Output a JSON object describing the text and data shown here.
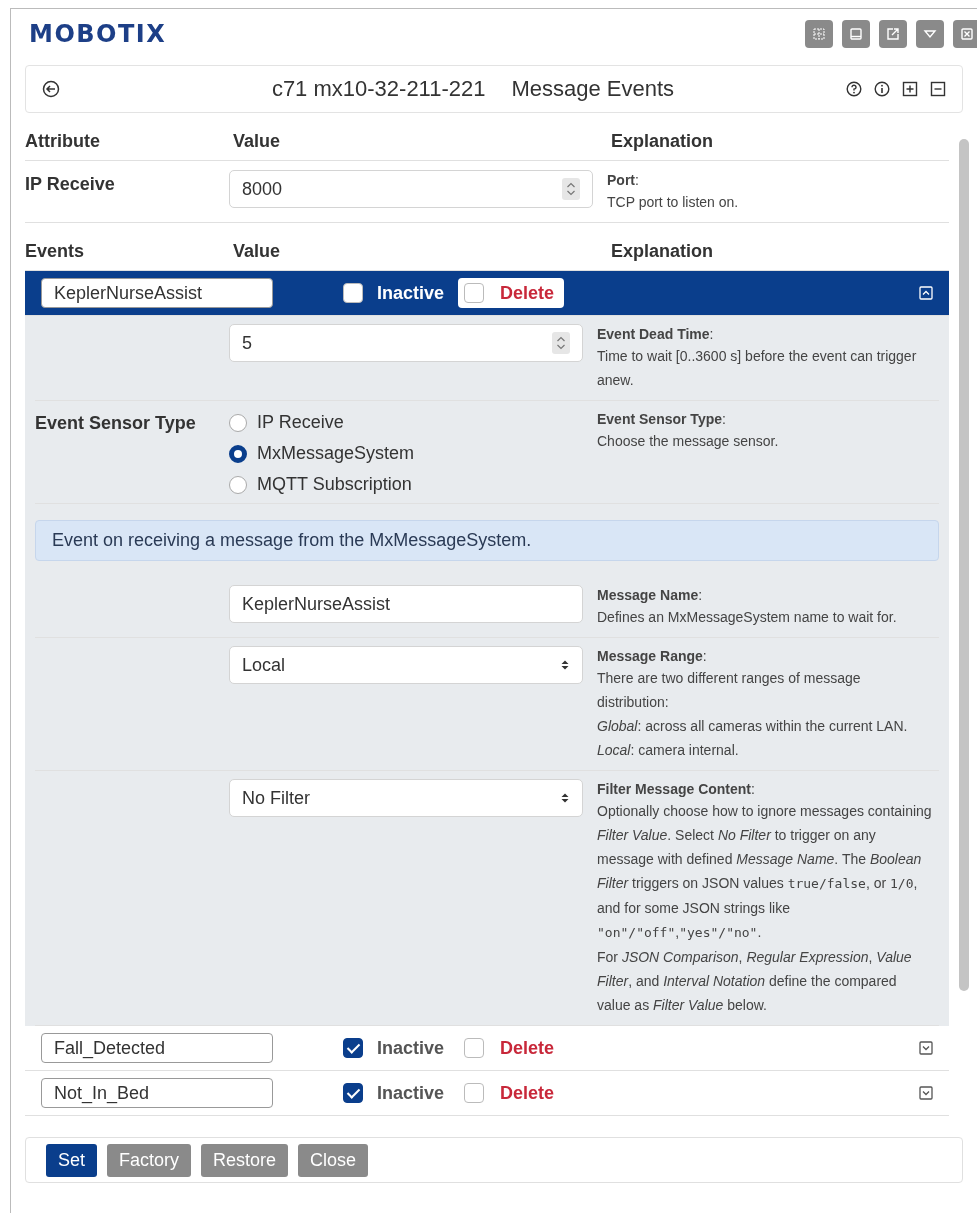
{
  "brand": "MOBOTIX",
  "title_bar": {
    "device": "c71 mx10-32-211-221",
    "title": "Message Events"
  },
  "header": [
    "Attribute",
    "Value",
    "Explanation"
  ],
  "ip_receive": {
    "label": "IP Receive",
    "value": "8000",
    "explanation": {
      "title": "**Port**:",
      "paragraphs": [
        [
          {
            "text": "TCP port to listen on."
          }
        ]
      ]
    }
  },
  "events_header": [
    "Events",
    "Value",
    "Explanation"
  ],
  "events": [
    {
      "name": "KeplerNurseAssist",
      "inactive": false,
      "delete": false,
      "expanded": true,
      "inactive_label": "Inactive",
      "delete_label": "Delete",
      "details": [
        {
          "kind": "number",
          "value": "5",
          "explanation": {
            "title": "**Event Dead Time**:",
            "paragraphs": [
              [
                {
                  "text": "Time to wait [0..3600 s] before the event can trigger anew."
                }
              ]
            ]
          }
        },
        {
          "kind": "radio",
          "label": "Event Sensor Type",
          "options": [
            {
              "label": "IP Receive",
              "selected": false
            },
            {
              "label": "MxMessageSystem",
              "selected": true
            },
            {
              "label": "MQTT Subscription",
              "selected": false
            }
          ],
          "explanation": {
            "title": "**Event Sensor Type**:",
            "paragraphs": [
              [
                {
                  "text": "Choose the message sensor."
                }
              ]
            ]
          }
        },
        {
          "kind": "notice",
          "text": "Event on receiving a message from the MxMessageSystem."
        },
        {
          "kind": "text",
          "value": "KeplerNurseAssist",
          "explanation": {
            "title": "**Message Name**:",
            "paragraphs": [
              [
                {
                  "text": "Defines an MxMessageSystem name to wait for."
                }
              ]
            ]
          }
        },
        {
          "kind": "select",
          "value": "Local",
          "explanation": {
            "title": "**Message Range**:",
            "paragraphs": [
              [
                {
                  "text": "There are two different ranges of message distribution:"
                }
              ],
              [
                {
                  "text": "*Global*: across all cameras within the current LAN."
                }
              ],
              [
                {
                  "text": "*Local*: camera internal."
                }
              ]
            ]
          }
        },
        {
          "kind": "select",
          "value": "No Filter",
          "explanation": {
            "title": "**Filter Message Content**:",
            "paragraphs": [
              [
                {
                  "text": "Optionally choose how to ignore messages containing *Filter Value*. Select *No Filter* to trigger on any message with defined *Message Name*. The *Boolean Filter* triggers on JSON values "
                },
                {
                  "text": "true/false",
                  "code": true
                },
                {
                  "text": ", or "
                },
                {
                  "text": "1/0",
                  "code": true
                },
                {
                  "text": ", and for some JSON strings like "
                },
                {
                  "text": "\"on\"/\"off\"",
                  "code": true
                },
                {
                  "text": ","
                },
                {
                  "text": "\"yes\"/\"no\"",
                  "code": true
                },
                {
                  "text": "."
                }
              ],
              [
                {
                  "text": "For *JSON Comparison*, *Regular Expression*, *Value Filter*, and *Interval Notation* define the compared value as *Filter Value* below."
                }
              ]
            ]
          }
        }
      ]
    },
    {
      "name": "Fall_Detected",
      "inactive": true,
      "delete": false,
      "expanded": false,
      "inactive_label": "Inactive",
      "delete_label": "Delete"
    },
    {
      "name": "Not_In_Bed",
      "inactive": true,
      "delete": false,
      "expanded": false,
      "inactive_label": "Inactive",
      "delete_label": "Delete"
    }
  ],
  "buttons": [
    {
      "label": "Set",
      "kind": "primary"
    },
    {
      "label": "Factory",
      "kind": "secondary"
    },
    {
      "label": "Restore",
      "kind": "secondary"
    },
    {
      "label": "Close",
      "kind": "secondary"
    }
  ]
}
